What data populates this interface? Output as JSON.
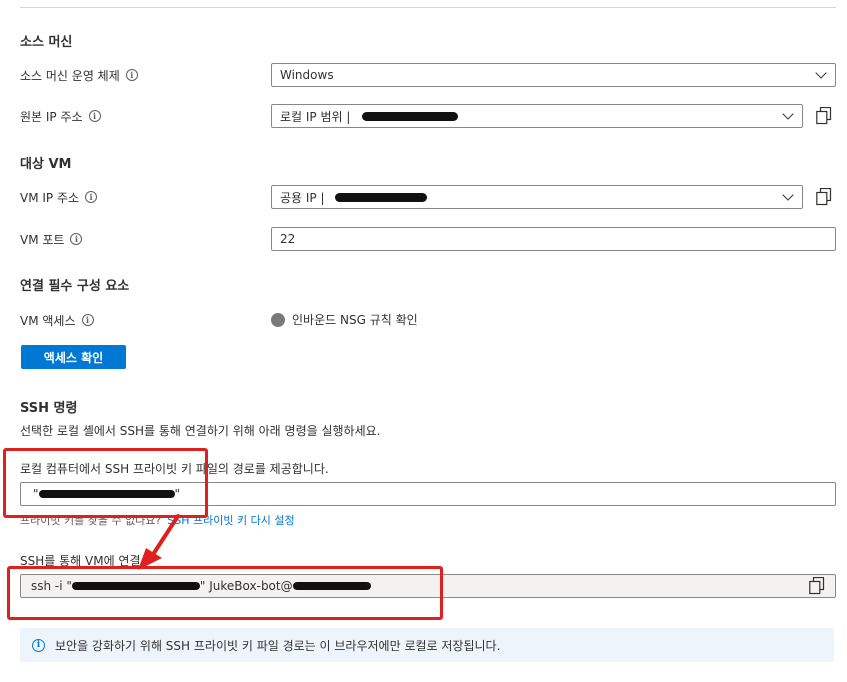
{
  "source": {
    "title": "소스 머신",
    "os_label": "소스 머신 운영 체제",
    "os_value": "Windows",
    "ip_label": "원본 IP 주소",
    "ip_value": "로컬 IP 범위   |"
  },
  "target": {
    "title": "대상 VM",
    "ip_label": "VM IP 주소",
    "ip_value": "공용 IP   |",
    "port_label": "VM 포트",
    "port_value": "22"
  },
  "prereq": {
    "title": "연결 필수 구성 요소",
    "access_label": "VM 액세스",
    "access_status": "인바운드 NSG 규칙 확인",
    "check_button": "액세스 확인"
  },
  "ssh": {
    "title": "SSH 명령",
    "description": "선택한 로컬 셸에서 SSH를 통해 연결하기 위해 아래 명령을 실행하세요.",
    "key_label": "로컬 컴퓨터에서 SSH 프라이빗 키 파일의 경로를 제공합니다.",
    "key_value_prefix": "\"",
    "key_value_suffix": "\"",
    "key_hint_text": "프라이빗 키를 찾을 수 없나요?",
    "key_hint_link": "SSH 프라이빗 키 다시 설정",
    "connect_label": "SSH를 통해 VM에 연결",
    "command_prefix": "ssh -i \"",
    "command_middle": "\" JukeBox-bot@",
    "info_text": "보안을 강화하기 위해 SSH 프라이빗 키 파일 경로는 이 브라우저에만 로컬로 저장됩니다."
  },
  "icons": {
    "info": "info-icon",
    "chevron": "chevron-down-icon",
    "copy": "copy-icon",
    "status": "status-dot-icon"
  },
  "colors": {
    "accent": "#0078d4",
    "annotation": "#e0201c",
    "status_dot": "#7a7a7a"
  }
}
